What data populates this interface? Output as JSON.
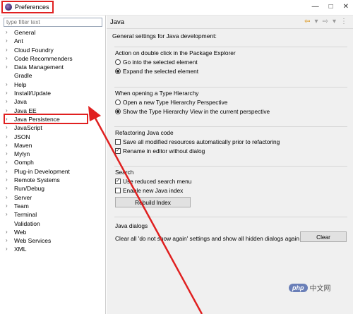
{
  "window": {
    "title": "Preferences",
    "icon": "eclipse-icon",
    "controls": [
      "—",
      "□",
      "✕"
    ]
  },
  "sidebar": {
    "filter_placeholder": "type filter text",
    "items": [
      {
        "label": "General",
        "expandable": true
      },
      {
        "label": "Ant",
        "expandable": true
      },
      {
        "label": "Cloud Foundry",
        "expandable": true
      },
      {
        "label": "Code Recommenders",
        "expandable": true
      },
      {
        "label": "Data Management",
        "expandable": true
      },
      {
        "label": "Gradle",
        "expandable": false
      },
      {
        "label": "Help",
        "expandable": true
      },
      {
        "label": "Install/Update",
        "expandable": true
      },
      {
        "label": "Java",
        "expandable": true,
        "selected": true
      },
      {
        "label": "Java EE",
        "expandable": true
      },
      {
        "label": "Java Persistence",
        "expandable": true
      },
      {
        "label": "JavaScript",
        "expandable": true
      },
      {
        "label": "JSON",
        "expandable": true
      },
      {
        "label": "Maven",
        "expandable": true
      },
      {
        "label": "Mylyn",
        "expandable": true
      },
      {
        "label": "Oomph",
        "expandable": true
      },
      {
        "label": "Plug-in Development",
        "expandable": true
      },
      {
        "label": "Remote Systems",
        "expandable": true
      },
      {
        "label": "Run/Debug",
        "expandable": true
      },
      {
        "label": "Server",
        "expandable": true
      },
      {
        "label": "Team",
        "expandable": true
      },
      {
        "label": "Terminal",
        "expandable": true
      },
      {
        "label": "Validation",
        "expandable": false
      },
      {
        "label": "Web",
        "expandable": true
      },
      {
        "label": "Web Services",
        "expandable": true
      },
      {
        "label": "XML",
        "expandable": true
      }
    ]
  },
  "page": {
    "title": "Java",
    "description": "General settings for Java development:",
    "nav": {
      "back": "⇦",
      "back_menu": "▾",
      "forward": "⇨",
      "forward_menu": "▾",
      "menu": "⋮"
    },
    "package_explorer": {
      "title": "Action on double click in the Package Explorer",
      "options": [
        {
          "label": "Go into the selected element",
          "selected": false
        },
        {
          "label": "Expand the selected element",
          "selected": true
        }
      ]
    },
    "type_hierarchy": {
      "title": "When opening a Type Hierarchy",
      "options": [
        {
          "label": "Open a new Type Hierarchy Perspective",
          "selected": false
        },
        {
          "label": "Show the Type Hierarchy View in the current perspective",
          "selected": true
        }
      ]
    },
    "refactoring": {
      "title": "Refactoring Java code",
      "options": [
        {
          "label": "Save all modified resources automatically prior to refactoring",
          "checked": false
        },
        {
          "label": "Rename in editor without dialog",
          "checked": true
        }
      ]
    },
    "search": {
      "title": "Search",
      "options": [
        {
          "label": "Use reduced search menu",
          "checked": true
        },
        {
          "label": "Enable new Java index",
          "checked": false
        }
      ],
      "rebuild_label": "Rebuild Index"
    },
    "dialogs": {
      "title": "Java dialogs",
      "text": "Clear all 'do not show again' settings and show all hidden dialogs again",
      "clear_label": "Clear"
    }
  },
  "watermark": {
    "badge": "php",
    "text": "中文网"
  },
  "colors": {
    "highlight": "#e02020",
    "accent": "#d88a00",
    "panel_bg": "#f0f0f0"
  }
}
